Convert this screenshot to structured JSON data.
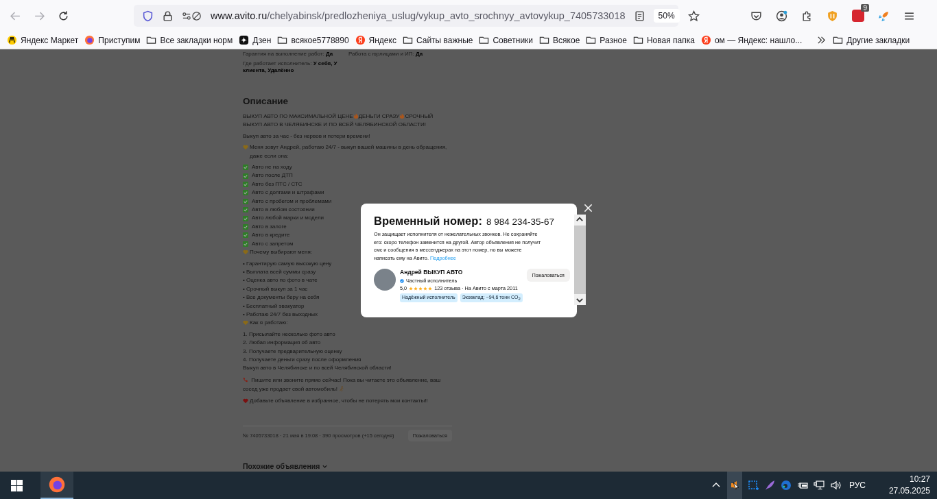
{
  "address_bar": {
    "host": "www.avito.ru",
    "path": "/chelyabinsk/predlozheniya_uslug/vykup_avto_srochnyy_avtovykup_7405733018",
    "zoom": "50%"
  },
  "adblock_badge": "9",
  "bookmarks": [
    {
      "kind": "market",
      "label": "Яндекс Маркет"
    },
    {
      "kind": "firefox",
      "label": "Приступим"
    },
    {
      "kind": "folder",
      "label": "Все закладки норм"
    },
    {
      "kind": "dzen",
      "label": "Дзен"
    },
    {
      "kind": "folder",
      "label": "всякое5778890"
    },
    {
      "kind": "yandex",
      "label": "Яндекс"
    },
    {
      "kind": "folder",
      "label": "Сайты важные"
    },
    {
      "kind": "folder",
      "label": "Советники"
    },
    {
      "kind": "folder",
      "label": "Всякое"
    },
    {
      "kind": "folder",
      "label": "Разное"
    },
    {
      "kind": "folder",
      "label": "Новая папка"
    },
    {
      "kind": "yandex",
      "label": "ом — Яндекс: нашло..."
    }
  ],
  "other_bookmarks": "Другие закладки",
  "page": {
    "specs": [
      {
        "label": "Гарантия на выполнение работ:",
        "value": "Да"
      },
      {
        "label": "Работа с юрлицами и ИП:",
        "value": "Да"
      },
      {
        "label": "Где работает исполнитель:",
        "value": "У себя, У клиента, Удалённо"
      }
    ],
    "description_title": "Описание",
    "description": [
      {
        "kind": "fire",
        "parts": [
          "ВЫКУП АВТО ПО МАКСИМАЛЬНОЙ ЦЕНЕ",
          "ДЕНЬГИ СРАЗУ",
          "СРОЧНЫЙ ВЫКУП АВТО В ЧЕЛЯБИНСКЕ И ПО ВСЕЙ ЧЕЛЯБИНСКОЙ ОБЛАСТИ!"
        ]
      },
      {
        "kind": "para",
        "text": "Выкуп авто за час - без нервов и потери времени!"
      },
      {
        "kind": "heart",
        "text": "Меня зовут Андрей, работаю 24/7 - выкуп вашей машины в день обращения, даже если она:"
      },
      {
        "kind": "check",
        "text": "Авто не на ходу"
      },
      {
        "kind": "check",
        "text": "Авто после ДТП"
      },
      {
        "kind": "check",
        "text": "Авто без ПТС / СТС"
      },
      {
        "kind": "check",
        "text": "Авто с долгами и штрафами"
      },
      {
        "kind": "check",
        "text": "Авто с пробегом и проблемами"
      },
      {
        "kind": "check",
        "text": "Авто в любом состоянии"
      },
      {
        "kind": "check",
        "text": "Авто любой марки и модели"
      },
      {
        "kind": "check",
        "text": "Авто в залоге"
      },
      {
        "kind": "check",
        "text": "Авто в кредите"
      },
      {
        "kind": "check",
        "text": "Авто с запретом"
      },
      {
        "kind": "heart",
        "text": "Почему выбирают меня:"
      },
      {
        "kind": "line",
        "text": "• Гарантирую самую высокую цену"
      },
      {
        "kind": "line",
        "text": "• Выплата всей суммы сразу"
      },
      {
        "kind": "line",
        "text": "• Оценка авто по фото в чате"
      },
      {
        "kind": "line",
        "text": "• Срочный выкуп за 1 час"
      },
      {
        "kind": "line",
        "text": "• Все документы беру на себя"
      },
      {
        "kind": "line",
        "text": "• Бесплатный эвакуатор"
      },
      {
        "kind": "line",
        "text": "• Работаю 24/7 без выходных"
      },
      {
        "kind": "heart",
        "text": "Как я работаю:"
      },
      {
        "kind": "line",
        "text": "1. Присылайте несколько фото авто"
      },
      {
        "kind": "line",
        "text": "2. Любая информация об авто"
      },
      {
        "kind": "line",
        "text": "3. Получаете предварительную оценку"
      },
      {
        "kind": "line",
        "text": "4. Получаете деньги сразу после оформления"
      },
      {
        "kind": "para",
        "text": "Выкуп авто в Челябинске и по всей Челябинской области!"
      },
      {
        "kind": "phone",
        "text": "Пишите или звоните прямо сейчас! Пока вы читаете это объявление, ваш сосед уже продает свой автомобиль!"
      },
      {
        "kind": "redheart",
        "text": "Добавьте объявление в избранное, чтобы не потерять мои контакты!!"
      }
    ],
    "meta": "№ 7405733018 · 21 мая в 19:08 · 390 просмотров (+15 сегодня)",
    "report_button": "Пожаловаться",
    "similar_title": "Похожие объявления"
  },
  "modal": {
    "title": "Временный номер:",
    "phone": "8 984 234-35-67",
    "description": "Он защищает исполнителя от нежелательных звонков. Не сохраняйте его: скоро телефон заменится на другой. Автор объявления не получит смс и сообщения в мессенджерах на этот номер, но вы можете написать ему на Авито.",
    "link": "Подробнее",
    "seller": {
      "name": "Андрей ВЫКУП АВТО",
      "type": "Частный исполнитель",
      "rating": "5,0",
      "stars": 5,
      "reviews": "123 отзыва · На Авито с марта 2011",
      "tags": [
        "Надёжный исполнитель",
        "Эковклад: −94,6 тонн CO$_{2}$"
      ]
    },
    "report_button": "Пожаловаться"
  },
  "taskbar": {
    "language": "РУС",
    "time": "10:27",
    "date": "27.05.2025"
  }
}
